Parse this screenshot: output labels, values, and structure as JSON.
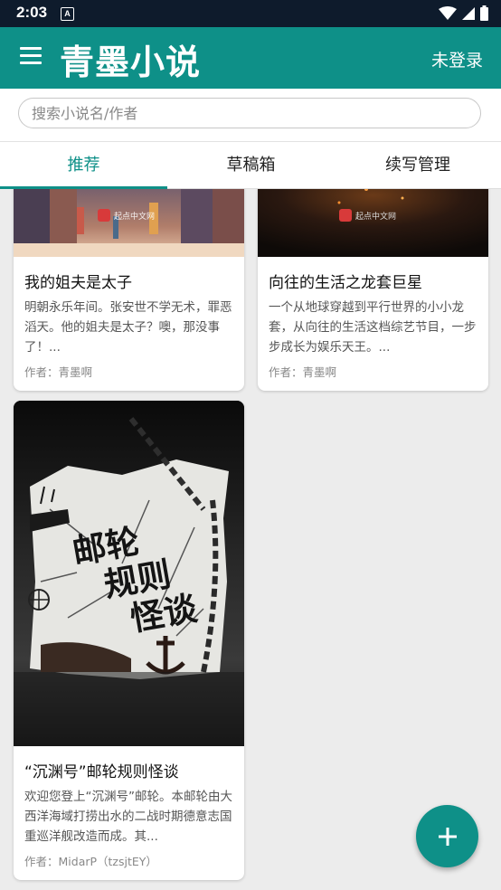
{
  "status_bar": {
    "time": "2:03",
    "notification_glyph": "A",
    "icons": [
      "wifi-icon",
      "signal-icon",
      "battery-icon"
    ]
  },
  "app_bar": {
    "title": "青墨小说",
    "login_label": "未登录",
    "color": "#0e9088"
  },
  "search": {
    "placeholder": "搜索小说名/作者",
    "value": ""
  },
  "tabs": [
    {
      "label": "推荐",
      "active": true
    },
    {
      "label": "草稿箱",
      "active": false
    },
    {
      "label": "续写管理",
      "active": false
    }
  ],
  "books": [
    {
      "title": "我的姐夫是太子",
      "description": "明朝永乐年间。张安世不学无术，罪恶滔天。他的姐夫是太子？噢，那没事了！...",
      "author": "作者：青墨啊",
      "cover_watermark": "起点中文网"
    },
    {
      "title": "向往的生活之龙套巨星",
      "description": "一个从地球穿越到平行世界的小小龙套，从向往的生活这档综艺节目，一步步成长为娱乐天王。...",
      "author": "作者：青墨啊",
      "cover_watermark": "起点中文网"
    },
    {
      "title": "“沉渊号”邮轮规则怪谈",
      "description": "欢迎您登上“沉渊号”邮轮。本邮轮由大西洋海域打捞出水的二战时期德意志国重巡洋舰改造而成。其...",
      "author": "作者：MidarP（tzsjtEY）",
      "cover_text": [
        "邮轮",
        "规则",
        "怪谈"
      ]
    }
  ],
  "fab": {
    "icon": "plus-icon"
  }
}
